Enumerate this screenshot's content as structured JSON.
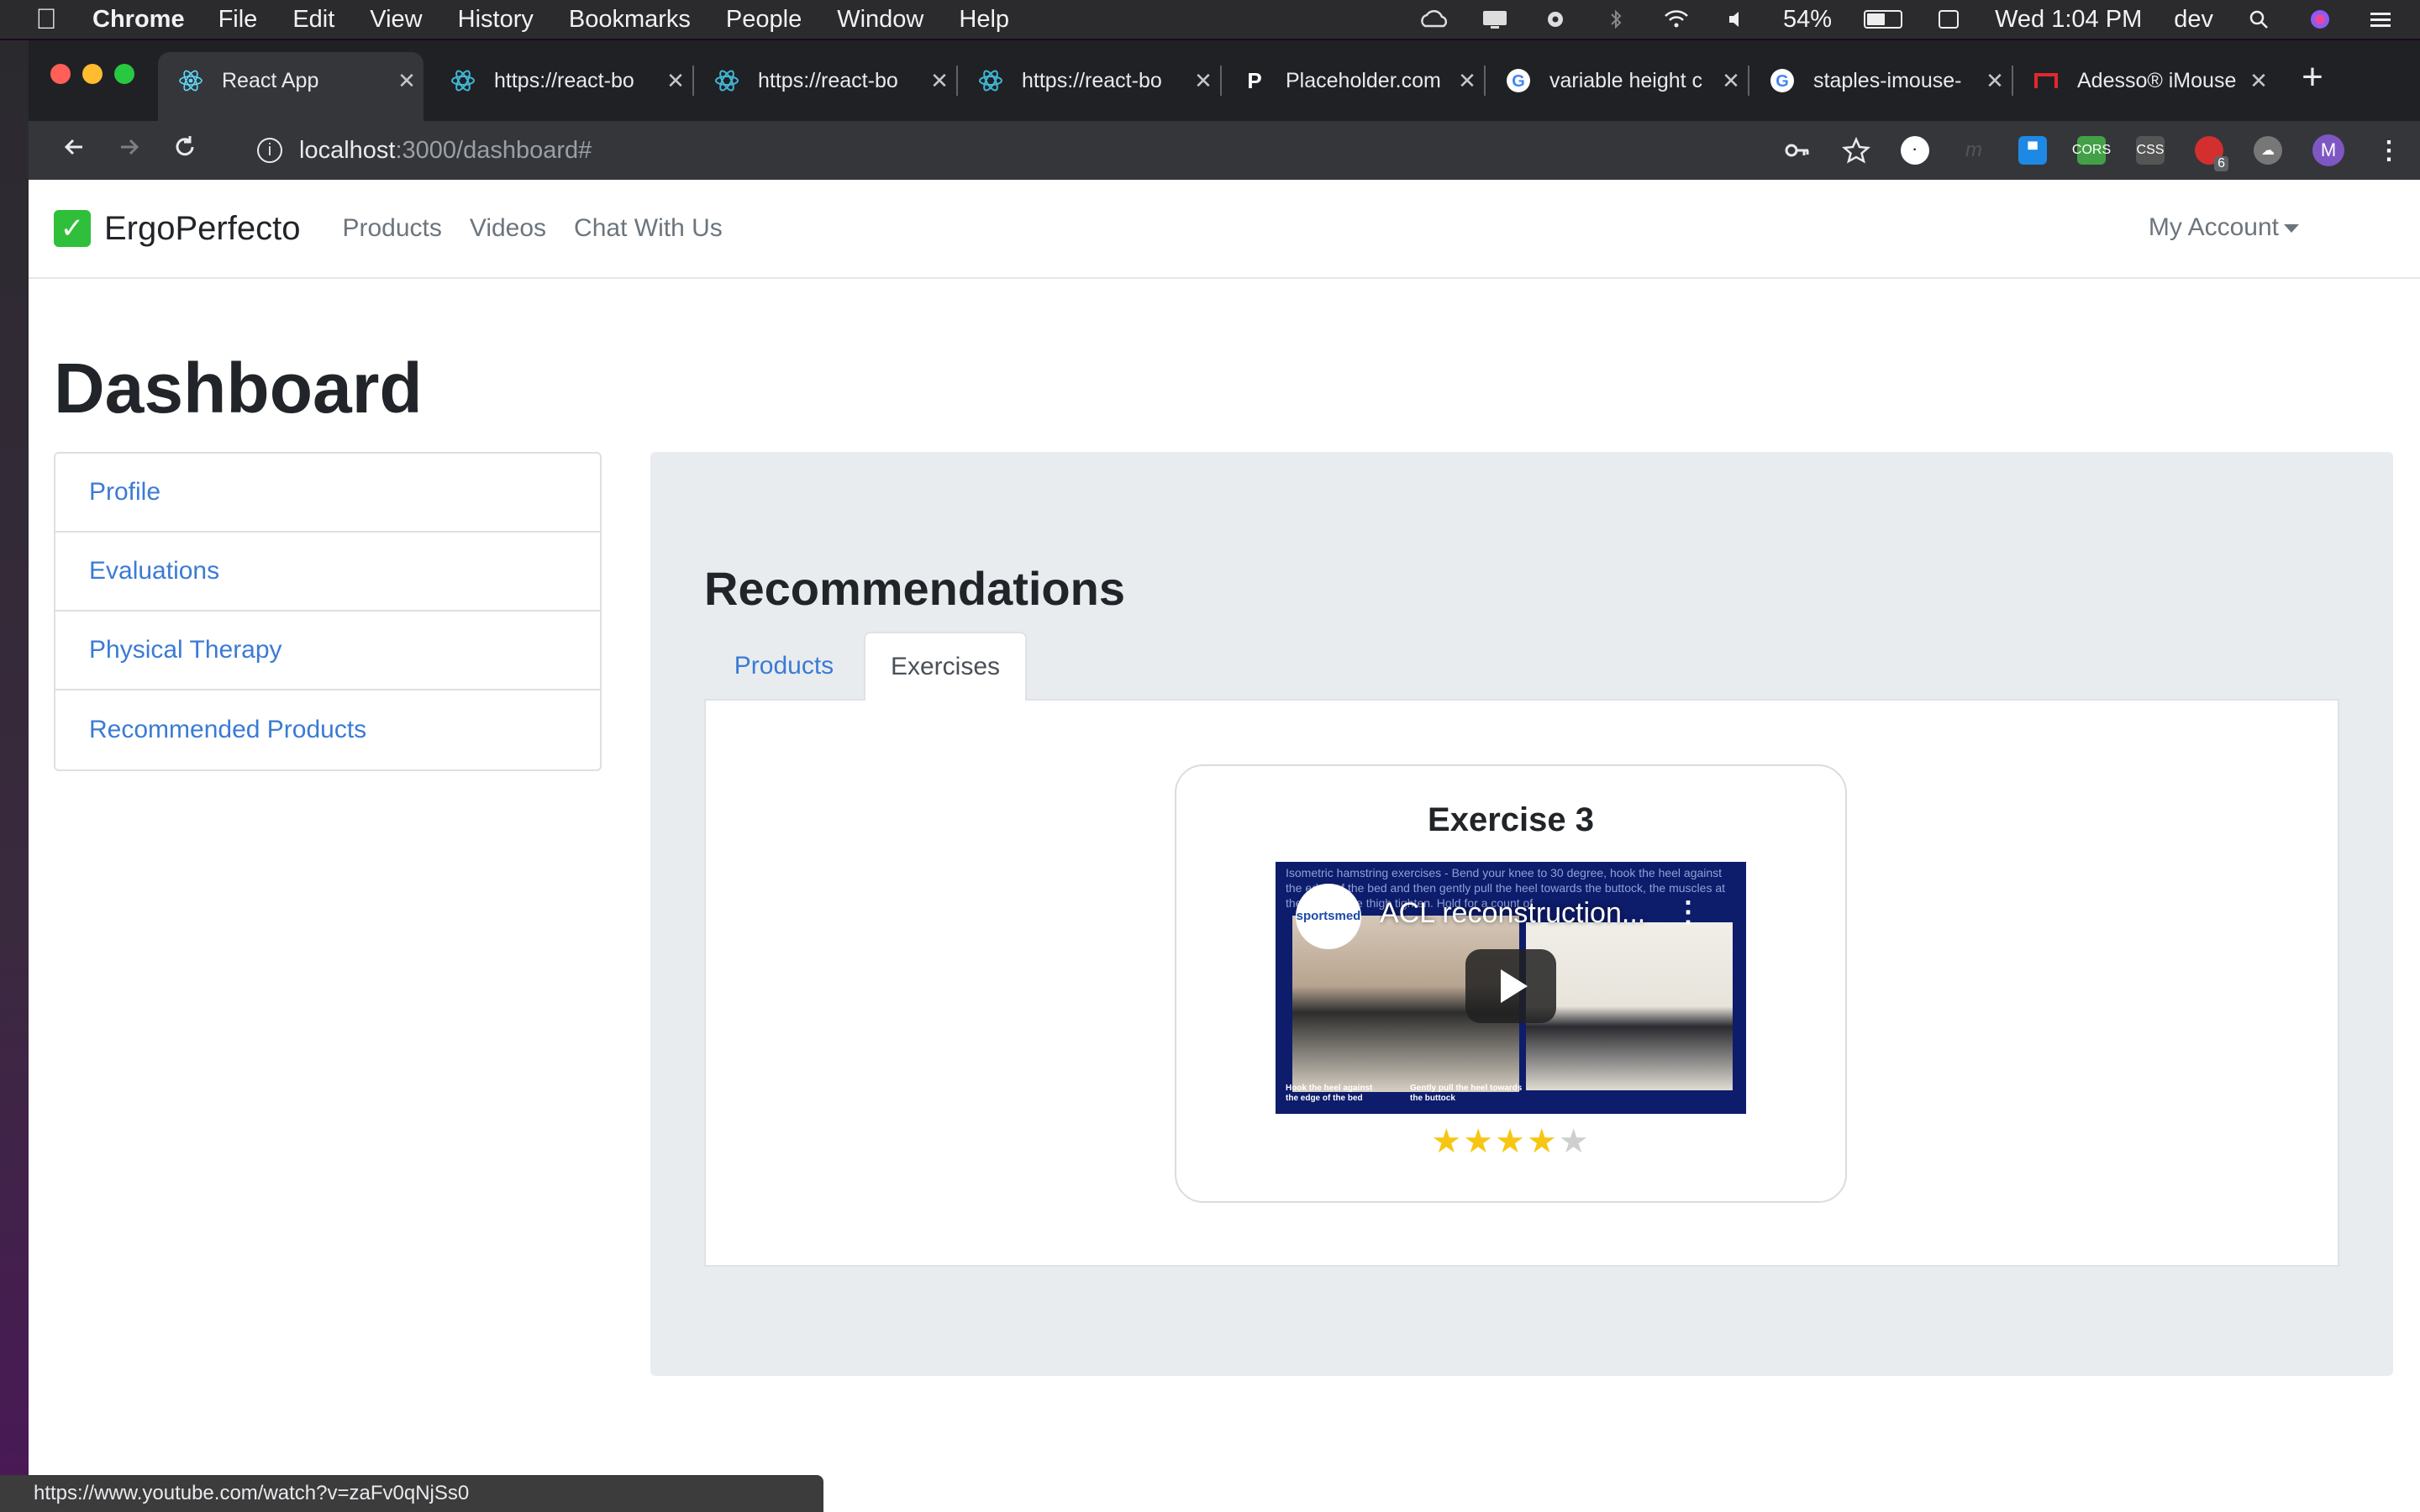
{
  "menubar": {
    "app": "Chrome",
    "items": [
      "File",
      "Edit",
      "View",
      "History",
      "Bookmarks",
      "People",
      "Window",
      "Help"
    ],
    "battery": "54%",
    "battery_level": 0.54,
    "clock": "Wed 1:04 PM",
    "user": "dev"
  },
  "browser": {
    "tabs": [
      {
        "label": "React App",
        "active": true,
        "favicon": "react-icon"
      },
      {
        "label": "https://react-bo",
        "favicon": "react-bootstrap-icon"
      },
      {
        "label": "https://react-bo",
        "favicon": "react-bootstrap-icon"
      },
      {
        "label": "https://react-bo",
        "favicon": "react-bootstrap-icon"
      },
      {
        "label": "Placeholder.com",
        "favicon": "placeholder-p-icon"
      },
      {
        "label": "variable height c",
        "favicon": "google-icon"
      },
      {
        "label": "staples-imouse-",
        "favicon": "google-icon"
      },
      {
        "label": "Adesso® iMouse",
        "favicon": "adesso-icon"
      }
    ],
    "url_host": "localhost",
    "url_path": ":3000/dashboard#",
    "profile_initial": "M",
    "ext_badge": "6"
  },
  "app": {
    "brand": "ErgoPerfecto",
    "nav": [
      "Products",
      "Videos",
      "Chat With Us"
    ],
    "account": "My Account",
    "page_title": "Dashboard",
    "sidebar": [
      "Profile",
      "Evaluations",
      "Physical Therapy",
      "Recommended Products"
    ],
    "recommendations_title": "Recommendations",
    "tabs": [
      "Products",
      "Exercises"
    ],
    "active_tab": "Exercises",
    "card": {
      "title": "Exercise 3",
      "video_title": "ACL reconstruction...",
      "video_text": "Isometric hamstring exercises - Bend your knee to 30 degree, hook the heel against the edge of the bed and then gently pull the heel towards the buttock, the muscles at the back of the thigh tighten. Hold for a count of",
      "video_logo": "sportsmed",
      "caption_left": "Hook the heel against the edge of the bed",
      "caption_right": "Gently pull the heel towards the buttock",
      "rating": 4,
      "rating_max": 5
    }
  },
  "status_url": "https://www.youtube.com/watch?v=zaFv0qNjSs0"
}
